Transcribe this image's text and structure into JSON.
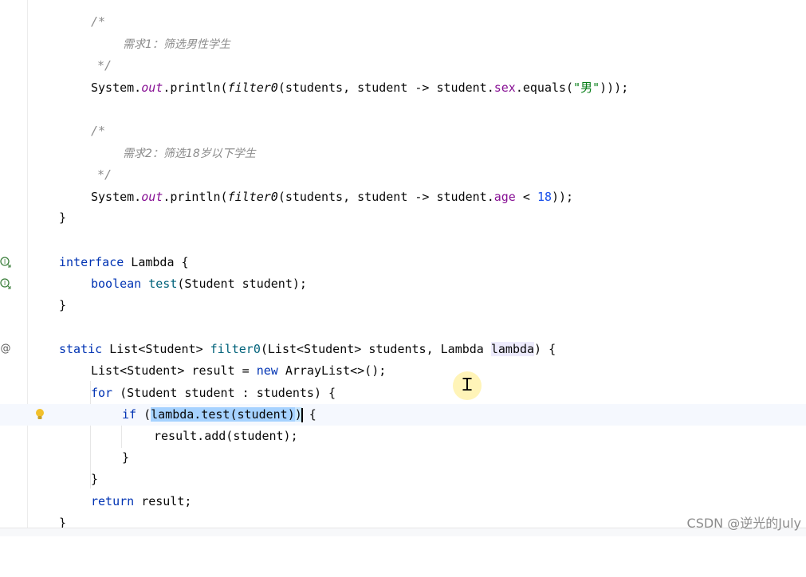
{
  "editor": {
    "lines": {
      "l1": "/*",
      "l2": "需求1：筛选男性学生",
      "l3": "*/",
      "l4a": "System.",
      "l4b": "out",
      "l4c": ".println(",
      "l4d": "filter0",
      "l4e": "(students, student -> student.",
      "l4f": "sex",
      "l4g": ".equals(",
      "l4h": "\"男\"",
      "l4i": ")));",
      "l6": "/*",
      "l7": "需求2：筛选18岁以下学生",
      "l8": "*/",
      "l9a": "System.",
      "l9b": "out",
      "l9c": ".println(",
      "l9d": "filter0",
      "l9e": "(students, student -> student.",
      "l9f": "age",
      "l9g": " < ",
      "l9h": "18",
      "l9i": "));",
      "l10": "}",
      "l12a": "interface",
      "l12b": " Lambda {",
      "l13a": "boolean",
      "l13b": " test",
      "l13c": "(Student student);",
      "l14": "}",
      "l16a": "static",
      "l16b": " List<Student> ",
      "l16c": "filter0",
      "l16d": "(List<Student> students, Lambda ",
      "l16e": "lambda",
      "l16f": ") {",
      "l17a": "List<Student> result = ",
      "l17b": "new",
      "l17c": " ArrayList<>();",
      "l18a": "for",
      "l18b": " (Student student : students) {",
      "l19a": "if",
      "l19b": " (",
      "l19c": "lambda.test(student)",
      "l19d": ")",
      "l19e": " {",
      "l20": "result.add(student);",
      "l21": "}",
      "l22": "}",
      "l23a": "return",
      "l23b": " result;",
      "l24": "}"
    },
    "gutter_icons": [
      "implemented-interface-icon",
      "implemented-method-icon",
      "annotation-icon",
      "intention-bulb-icon"
    ]
  },
  "watermark": "CSDN @逆光的July",
  "colors": {
    "keyword": "#0033b3",
    "field": "#871094",
    "string": "#067d17",
    "number": "#1750eb",
    "comment": "#8c8c8c",
    "selection": "#a6d2ff",
    "current_line": "#f5f8fe"
  }
}
